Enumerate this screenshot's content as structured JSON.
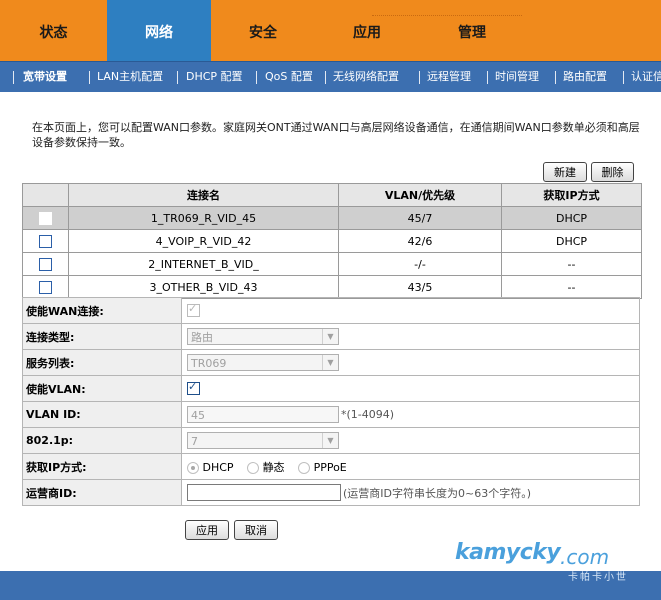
{
  "topnav": {
    "tabs": [
      {
        "label": "状态"
      },
      {
        "label": "网络"
      },
      {
        "label": "安全"
      },
      {
        "label": "应用"
      },
      {
        "label": "管理"
      }
    ],
    "active": "网络"
  },
  "subnav": {
    "items": [
      {
        "label": "宽带设置"
      },
      {
        "label": "LAN主机配置"
      },
      {
        "label": "DHCP 配置"
      },
      {
        "label": "QoS 配置"
      },
      {
        "label": "无线网络配置"
      },
      {
        "label": "远程管理"
      },
      {
        "label": "时间管理"
      },
      {
        "label": "路由配置"
      },
      {
        "label": "认证信"
      }
    ],
    "active": "宽带设置"
  },
  "description": "在本页面上，您可以配置WAN口参数。家庭网关ONT通过WAN口与高层网络设备通信，在通信期间WAN口参数单必须和高层设备参数保持一致。",
  "toolbar": {
    "new_label": "新建",
    "delete_label": "删除"
  },
  "wan_table": {
    "columns": [
      "",
      "连接名",
      "VLAN/优先级",
      "获取IP方式"
    ],
    "rows": [
      {
        "name": "1_TR069_R_VID_45",
        "vlan": "45/7",
        "ip": "DHCP",
        "selected": true
      },
      {
        "name": "4_VOIP_R_VID_42",
        "vlan": "42/6",
        "ip": "DHCP",
        "selected": false
      },
      {
        "name": "2_INTERNET_B_VID_",
        "vlan": "-/-",
        "ip": "--",
        "selected": false
      },
      {
        "name": "3_OTHER_B_VID_43",
        "vlan": "43/5",
        "ip": "--",
        "selected": false
      }
    ]
  },
  "form": {
    "enable_wan": {
      "label": "使能WAN连接:",
      "checked": true
    },
    "conn_type": {
      "label": "连接类型:",
      "value": "路由"
    },
    "service_list": {
      "label": "服务列表:",
      "value": "TR069"
    },
    "enable_vlan": {
      "label": "使能VLAN:",
      "checked": true
    },
    "vlan_id": {
      "label": "VLAN ID:",
      "value": "45",
      "hint": "*(1-4094)"
    },
    "dot1p": {
      "label": "802.1p:",
      "value": "7"
    },
    "ip_mode": {
      "label": "获取IP方式:",
      "options": [
        "DHCP",
        "静态",
        "PPPoE"
      ],
      "selected": "DHCP"
    },
    "isp_id": {
      "label": "运营商ID:",
      "value": "",
      "hint": "(运营商ID字符串长度为0~63个字符。)"
    }
  },
  "actions": {
    "apply_label": "应用",
    "cancel_label": "取消"
  },
  "watermark": {
    "text1": "kamycky",
    "text2": ".com",
    "text3": "卡帕卡小世"
  }
}
